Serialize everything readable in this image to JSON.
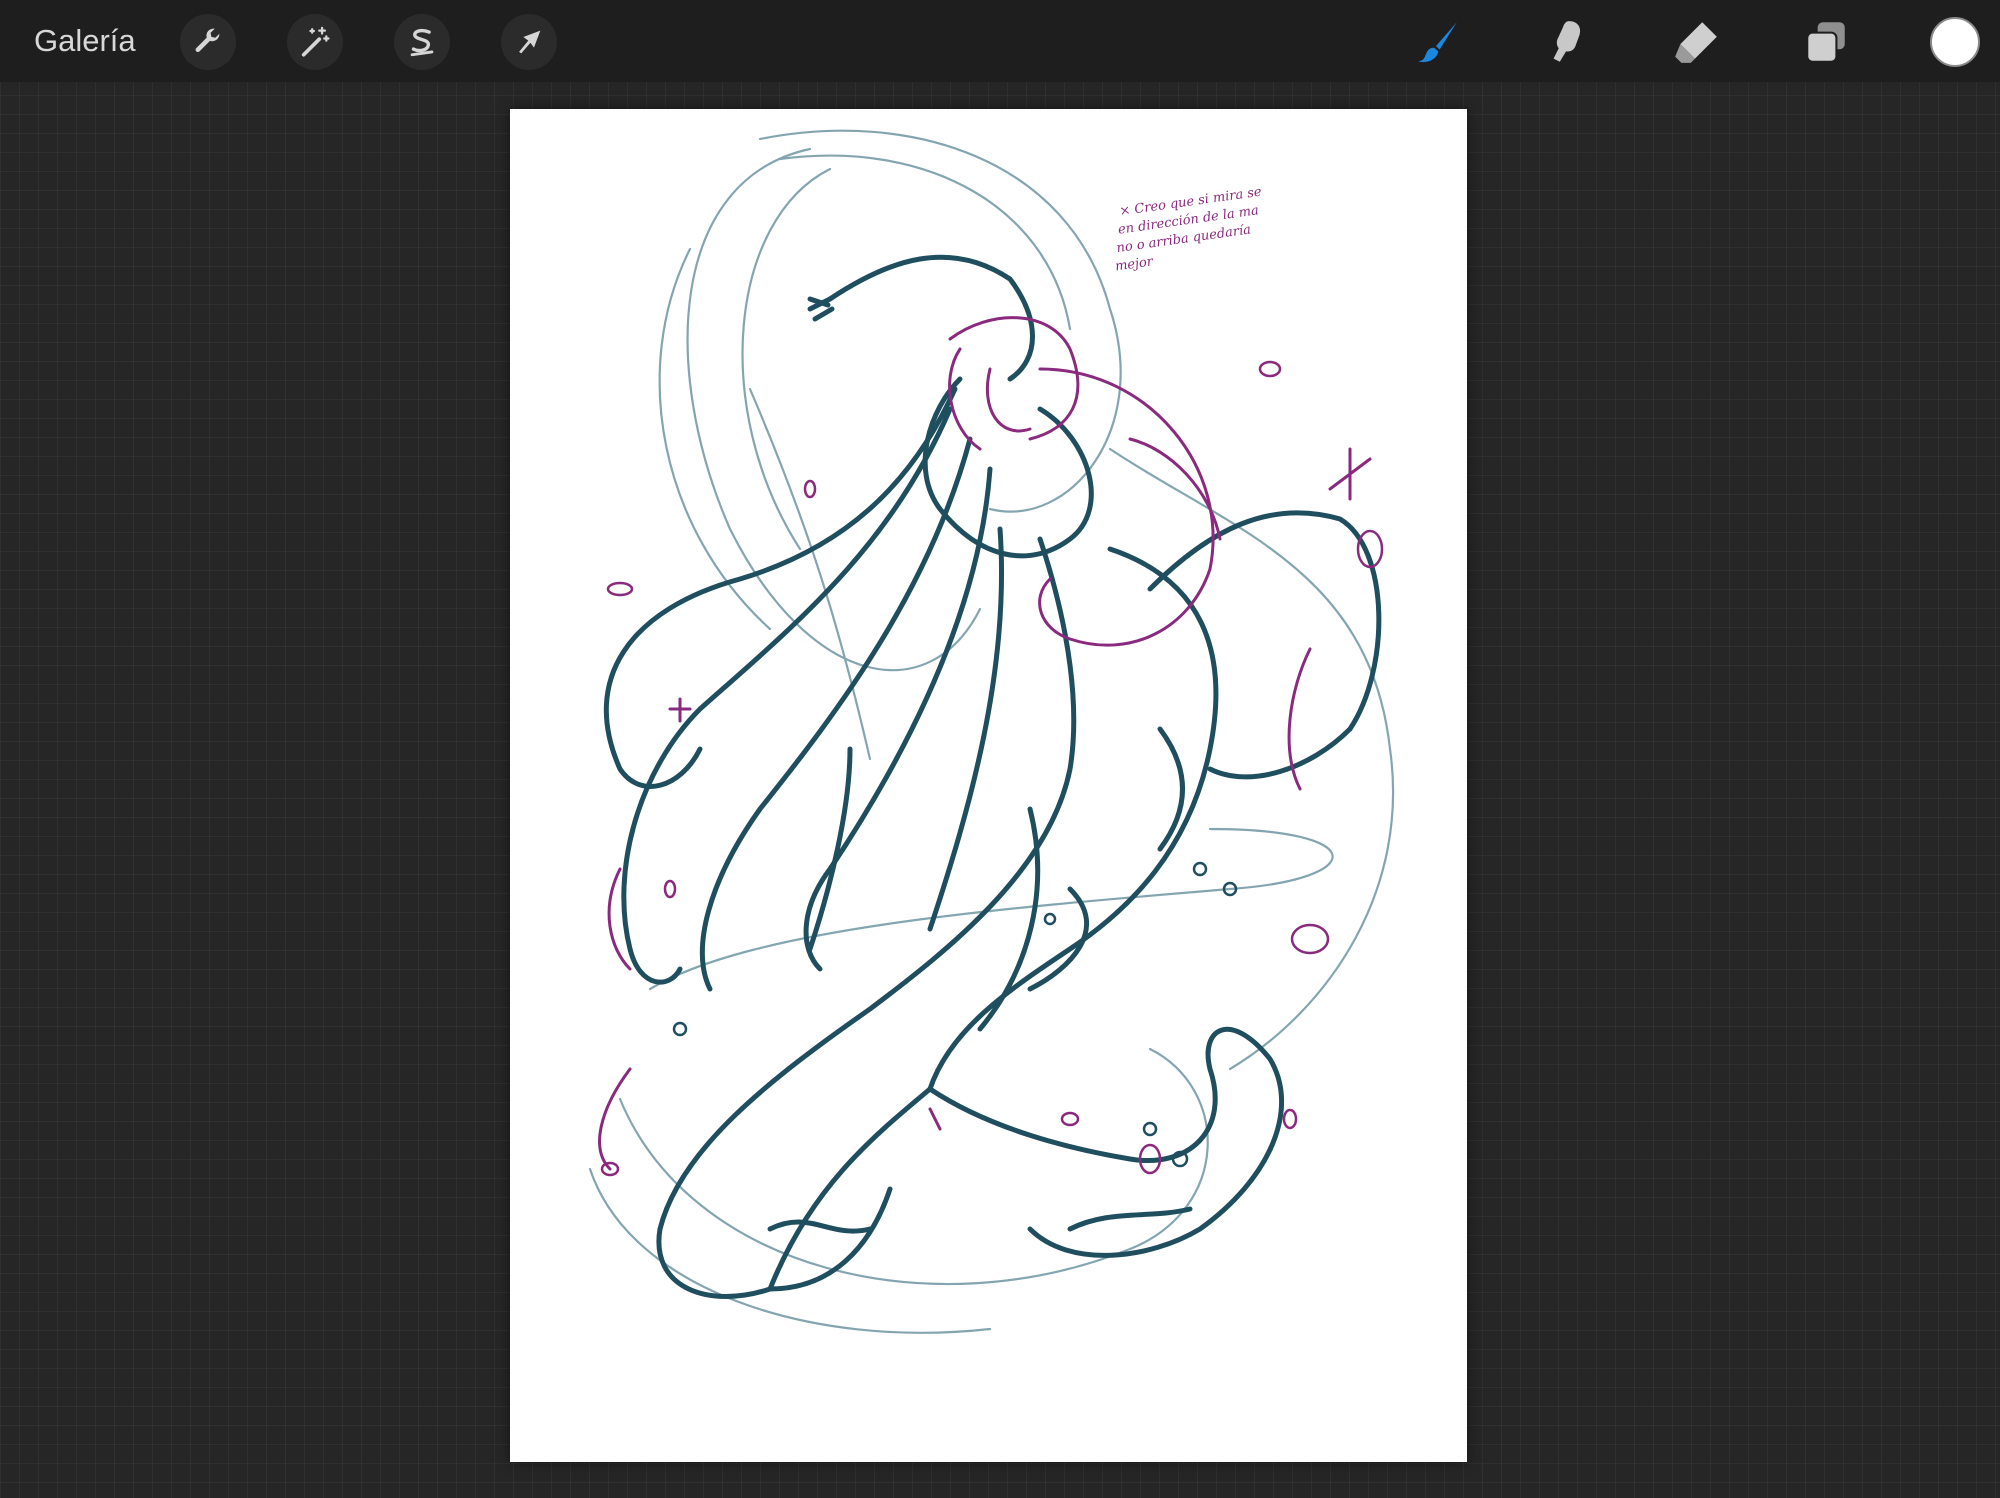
{
  "toolbar": {
    "gallery_label": "Galería",
    "left_tools": [
      {
        "name": "actions",
        "icon": "wrench-icon"
      },
      {
        "name": "adjustments",
        "icon": "magic-wand-icon"
      },
      {
        "name": "selection",
        "icon": "selection-s-icon"
      },
      {
        "name": "transform",
        "icon": "arrow-cursor-icon"
      }
    ],
    "right_tools": [
      {
        "name": "brush",
        "icon": "brush-icon",
        "active": true
      },
      {
        "name": "smudge",
        "icon": "smudge-finger-icon"
      },
      {
        "name": "eraser",
        "icon": "eraser-icon"
      },
      {
        "name": "layers",
        "icon": "layers-icon"
      },
      {
        "name": "color",
        "icon": "color-swatch",
        "value": "#ffffff"
      }
    ],
    "active_color": "#1a88e0"
  },
  "canvas": {
    "background": "#ffffff",
    "sketch_colors": {
      "dark": "#1f4e5f",
      "light": "#6f96a3",
      "accent": "#8a2a7e"
    },
    "handwritten_note": "× Creo que si mira se en dirección de la ma no o arriba quedaría mejor"
  }
}
